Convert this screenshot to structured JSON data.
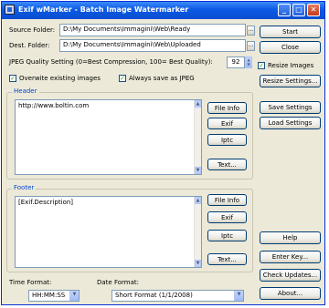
{
  "window": {
    "title": "Exif wMarker - Batch Image Watermarker"
  },
  "folders": {
    "source_label": "Source Folder:",
    "source_value": "D:\\My Documents\\Immagini\\Web\\Ready",
    "dest_label": "Dest. Folder:",
    "dest_value": "D:\\My Documents\\Immagini\\Web\\Uploaded",
    "browse_label": "..."
  },
  "quality": {
    "label": "JPEG Quality Setting (0=Best Compression, 100= Best Quality):",
    "value": "92"
  },
  "options": {
    "overwrite_label": "Overwite existing images",
    "overwrite_checked": true,
    "always_jpeg_label": "Always save as JPEG",
    "always_jpeg_checked": true,
    "resize_label": "Resize Images",
    "resize_checked": true
  },
  "header": {
    "title": "Header",
    "text": "http://www.boltin.com",
    "buttons": {
      "file_info": "File Info",
      "exif": "Exif",
      "iptc": "Iptc",
      "text": "Text..."
    }
  },
  "footer": {
    "title": "Footer",
    "text": "[Exif.Description]",
    "buttons": {
      "file_info": "File Info",
      "exif": "Exif",
      "iptc": "Iptc",
      "text": "Text..."
    }
  },
  "right_buttons": {
    "start": "Start",
    "close": "Close",
    "resize_settings": "Resize Settings...",
    "save_settings": "Save Settings",
    "load_settings": "Load Settings",
    "help": "Help",
    "enter_key": "Enter Key...",
    "check_updates": "Check Updates...",
    "about": "About..."
  },
  "formats": {
    "time_label": "Time Format:",
    "time_value": "HH:MM:SS",
    "date_label": "Date Format:",
    "date_value": "Short Format (1/1/2008)"
  },
  "icons": {
    "app": "app-icon",
    "minimize": "minimize-icon",
    "maximize": "maximize-icon",
    "close": "close-icon",
    "dropdown": "chevron-down-icon",
    "scroll_up": "scroll-up-icon",
    "scroll_down": "scroll-down-icon"
  }
}
